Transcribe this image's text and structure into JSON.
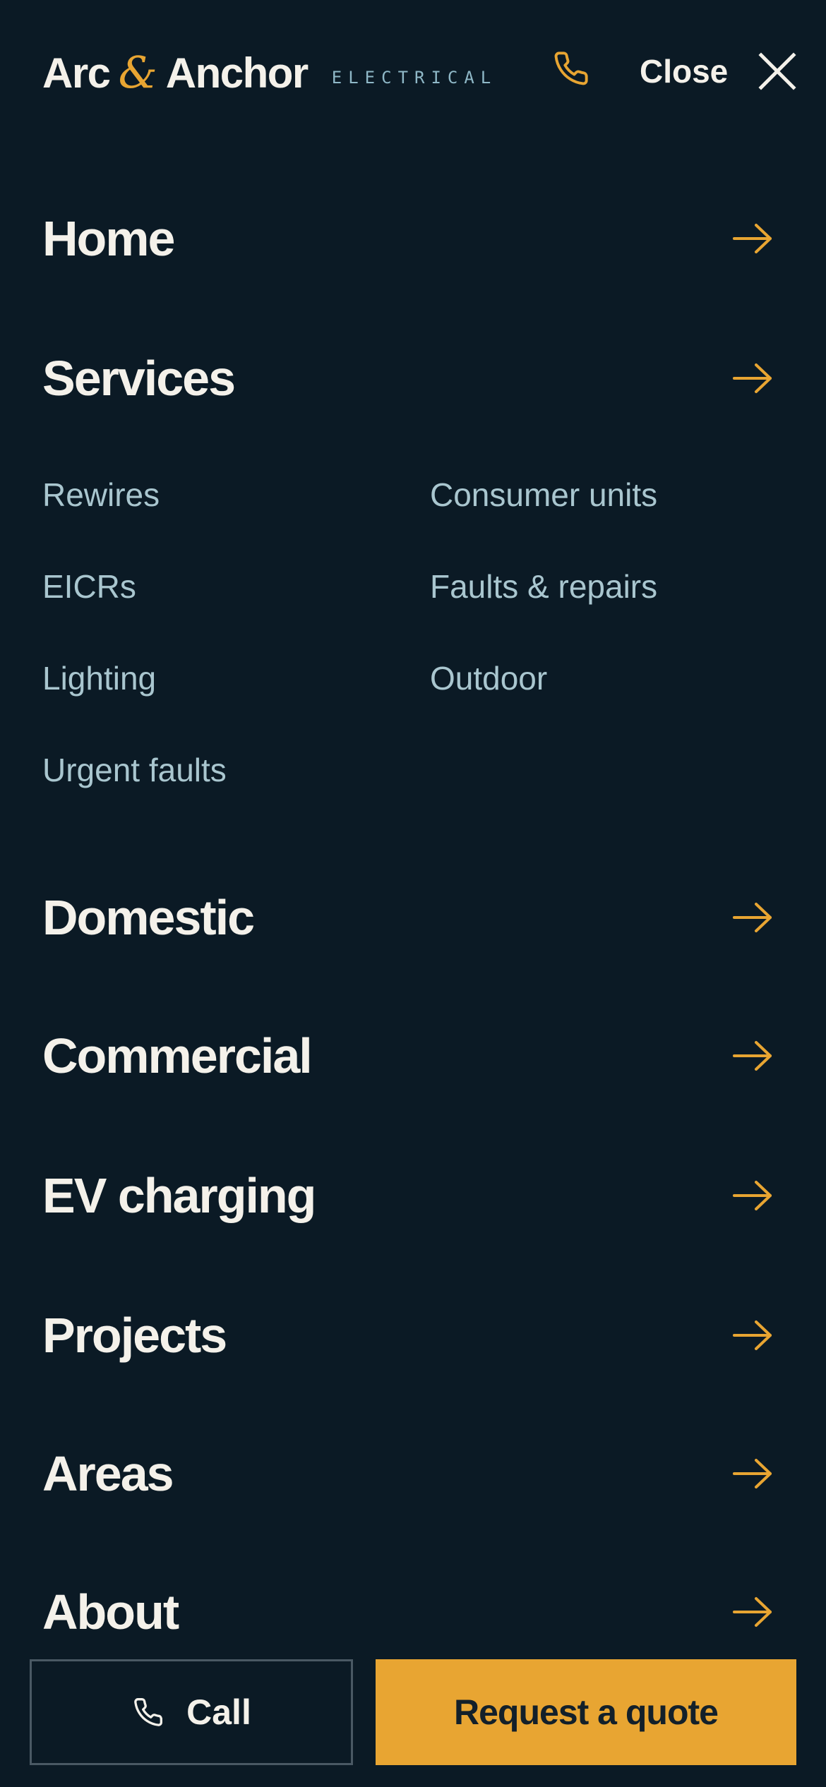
{
  "brand": {
    "name_left": "Arc",
    "ampersand": "&",
    "name_right": "Anchor",
    "subtitle": "ELECTRICAL"
  },
  "header": {
    "phone_icon": "phone-icon",
    "close_label": "Close",
    "close_icon": "close-x-icon"
  },
  "colors": {
    "background": "#0b1a25",
    "accent": "#e8a532",
    "text": "#f4f1ea",
    "muted": "#a9c6cf",
    "subtitle": "#8fb8c7"
  },
  "menu": {
    "items": [
      {
        "label": "Home"
      },
      {
        "label": "Services"
      },
      {
        "label": "Domestic"
      },
      {
        "label": "Commercial"
      },
      {
        "label": "EV charging"
      },
      {
        "label": "Projects"
      },
      {
        "label": "Areas"
      },
      {
        "label": "About"
      }
    ],
    "arrow_icon": "arrow-right-icon",
    "services_sub": [
      {
        "label": "Rewires"
      },
      {
        "label": "Consumer units"
      },
      {
        "label": "EICRs"
      },
      {
        "label": "Faults & repairs"
      },
      {
        "label": "Lighting"
      },
      {
        "label": "Outdoor"
      },
      {
        "label": "Urgent faults"
      }
    ]
  },
  "actions": {
    "call_label": "Call",
    "call_icon": "phone-icon",
    "quote_label": "Request a quote"
  }
}
